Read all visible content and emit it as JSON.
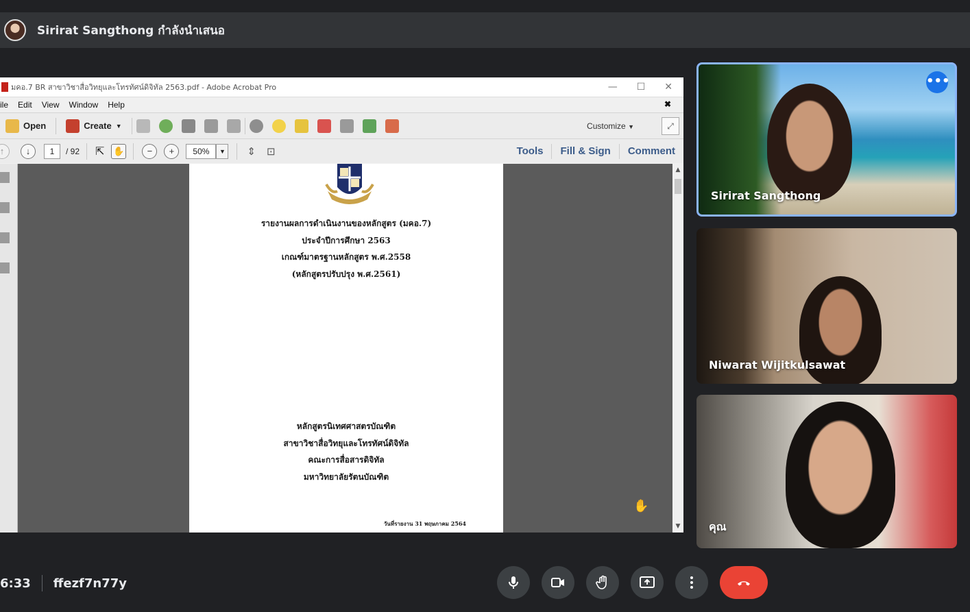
{
  "presenter_bar": {
    "text": "Sirirat Sangthong กำลังนำเสนอ"
  },
  "acrobat": {
    "window_title": "มคอ.7 BR สาขาวิชาสื่อวิทยุและโทรทัศน์ดิจิทัล 2563.pdf - Adobe Acrobat Pro",
    "menu": [
      "ile",
      "Edit",
      "View",
      "Window",
      "Help"
    ],
    "toolbar": {
      "open_label": "Open",
      "create_label": "Create",
      "customize_label": "Customize"
    },
    "nav": {
      "page_current": "1",
      "page_total": "/ 92",
      "zoom": "50%"
    },
    "panels": {
      "tools": "Tools",
      "fill_sign": "Fill & Sign",
      "comment": "Comment"
    },
    "document": {
      "title_lines": [
        "รายงานผลการดำเนินงานของหลักสูตร (มคอ.7)",
        "ประจำปีการศึกษา 2563",
        "เกณฑ์มาตรฐานหลักสูตร พ.ศ.2558",
        "(หลักสูตรปรับปรุง พ.ศ.2561)"
      ],
      "org_lines": [
        "หลักสูตรนิเทศศาสตรบัณฑิต",
        "สาขาวิชาสื่อวิทยุและโทรทัศน์ดิจิทัล",
        "คณะการสื่อสารดิจิทัล",
        "มหาวิทยาลัยรัตนบัณฑิต"
      ],
      "date_line": "วันที่รายงาน 31 พฤษภาคม 2564"
    }
  },
  "participants": [
    {
      "name": "Sirirat Sangthong",
      "active_speaker": true
    },
    {
      "name": "Niwarat Wijitkulsawat",
      "active_speaker": false
    },
    {
      "name": "คุณ",
      "active_speaker": false
    }
  ],
  "bottom_bar": {
    "time": "6:33",
    "meeting_code": "ffezf7n77y"
  },
  "colors": {
    "accent": "#8ab4f8",
    "end_call": "#ea4335",
    "control_bg": "#3c4043",
    "background": "#202124"
  }
}
